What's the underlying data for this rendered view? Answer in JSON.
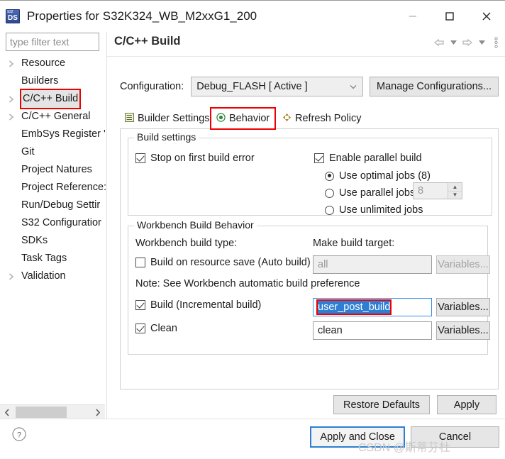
{
  "window": {
    "title": "Properties for S32K324_WB_M2xxG1_200",
    "app_icon": "s32ds-icon",
    "controls": {
      "minimize": "minimize-icon",
      "maximize": "maximize-icon",
      "close": "close-icon"
    }
  },
  "sidebar": {
    "filter_placeholder": "type filter text",
    "items": [
      {
        "label": "Resource",
        "expandable": true,
        "highlighted": false
      },
      {
        "label": "Builders",
        "expandable": false,
        "highlighted": false
      },
      {
        "label": "C/C++ Build",
        "expandable": true,
        "highlighted": true
      },
      {
        "label": "C/C++ General",
        "expandable": true,
        "highlighted": false
      },
      {
        "label": "EmbSys Register '",
        "expandable": false,
        "highlighted": false
      },
      {
        "label": "Git",
        "expandable": false,
        "highlighted": false
      },
      {
        "label": "Project Natures",
        "expandable": false,
        "highlighted": false
      },
      {
        "label": "Project Reference:",
        "expandable": false,
        "highlighted": false
      },
      {
        "label": "Run/Debug Settir",
        "expandable": false,
        "highlighted": false
      },
      {
        "label": "S32 Configuratior",
        "expandable": false,
        "highlighted": false
      },
      {
        "label": "SDKs",
        "expandable": false,
        "highlighted": false
      },
      {
        "label": "Task Tags",
        "expandable": false,
        "highlighted": false
      },
      {
        "label": "Validation",
        "expandable": true,
        "highlighted": false
      }
    ],
    "scroll_left": "scroll-left-icon",
    "scroll_right": "scroll-right-icon"
  },
  "panel": {
    "title": "C/C++ Build",
    "tools": [
      "back-icon",
      "back-dropdown-icon",
      "forward-icon",
      "forward-dropdown-icon",
      "view-menu-icon"
    ],
    "configuration": {
      "label": "Configuration:",
      "value": "Debug_FLASH  [ Active ]",
      "manage_button": "Manage Configurations..."
    },
    "tabs": [
      {
        "label": "Builder Settings",
        "icon": "builder-settings-icon",
        "selected": false
      },
      {
        "label": "Behavior",
        "icon": "behavior-icon",
        "selected": true
      },
      {
        "label": "Refresh Policy",
        "icon": "refresh-policy-icon",
        "selected": false
      }
    ],
    "build_settings": {
      "group_label": "Build settings",
      "stop_on_first_error": {
        "label": "Stop on first build error",
        "checked": true
      },
      "enable_parallel_build": {
        "label": "Enable parallel build",
        "checked": true
      },
      "radios": [
        {
          "label": "Use optimal jobs (8)",
          "selected": true
        },
        {
          "label": "Use parallel jobs:",
          "selected": false
        },
        {
          "label": "Use unlimited jobs",
          "selected": false
        }
      ],
      "jobs_spinner": {
        "value": "8",
        "disabled": true,
        "up": "spinner-up-icon",
        "down": "spinner-down-icon"
      }
    },
    "workbench_behavior": {
      "group_label": "Workbench Build Behavior",
      "build_type_label": "Workbench build type:",
      "make_target_label": "Make build target:",
      "note": "Note: See Workbench automatic build preference",
      "rows": [
        {
          "label": "Build on resource save (Auto build)",
          "checked": false,
          "target": "all",
          "target_disabled": true,
          "target_selected": false,
          "variables_button": "Variables...",
          "variables_disabled": true
        },
        {
          "label": "Build (Incremental build)",
          "checked": true,
          "target": "user_post_build",
          "target_disabled": false,
          "target_selected": true,
          "variables_button": "Variables...",
          "variables_disabled": false
        },
        {
          "label": "Clean",
          "checked": true,
          "target": "clean",
          "target_disabled": false,
          "target_selected": false,
          "variables_button": "Variables...",
          "variables_disabled": false
        }
      ]
    },
    "actions": {
      "restore_defaults": "Restore Defaults",
      "apply": "Apply"
    }
  },
  "footer": {
    "help_icon": "help-icon",
    "apply_and_close": "Apply and Close",
    "cancel": "Cancel",
    "watermark": "CSDN @斯蒂芬杜"
  },
  "colors": {
    "highlight_red": "#ee0000",
    "selection_blue": "#2c7fd4",
    "focus_blue": "#2b7fd1"
  }
}
